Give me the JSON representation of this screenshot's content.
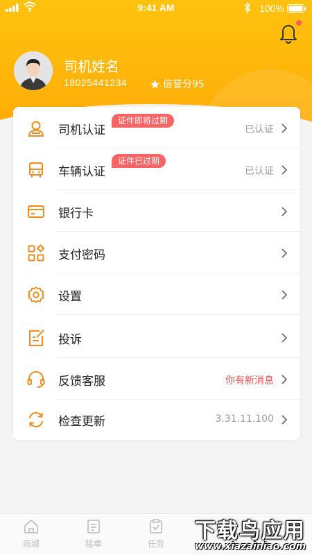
{
  "status_bar": {
    "time": "9:41 AM",
    "battery": "100%"
  },
  "profile": {
    "name": "司机姓名",
    "phone": "18025441234",
    "credit": "信誉分95",
    "notification_dot": true
  },
  "menu": [
    {
      "label": "司机认证",
      "icon": "driver-icon",
      "badge": "证件即将过期",
      "value": "已认证"
    },
    {
      "label": "车辆认证",
      "icon": "vehicle-icon",
      "badge": "证件已过期",
      "value": "已认证"
    },
    {
      "label": "银行卡",
      "icon": "bank-card-icon",
      "badge": "",
      "value": ""
    },
    {
      "label": "支付密码",
      "icon": "payment-password-icon",
      "badge": "",
      "value": ""
    },
    {
      "label": "设置",
      "icon": "settings-icon",
      "badge": "",
      "value": ""
    },
    {
      "label": "投诉",
      "icon": "complaint-icon",
      "badge": "",
      "value": ""
    },
    {
      "label": "反馈客服",
      "icon": "customer-service-icon",
      "badge": "",
      "value": "你有新消息"
    },
    {
      "label": "检查更新",
      "icon": "update-icon",
      "badge": "",
      "value": "3.31.11.100"
    }
  ],
  "tabs": [
    {
      "label": "商城",
      "icon": "mall-icon"
    },
    {
      "label": "接单",
      "icon": "orders-icon"
    },
    {
      "label": "任务",
      "icon": "task-icon"
    }
  ],
  "watermark": {
    "cn": "下载鸟应用",
    "en": "www.xiazainiao.com"
  },
  "colors": {
    "accent": "#ffb30a",
    "icon": "#f28b1d",
    "badge": "#f66464",
    "alert_text": "#f25454"
  }
}
